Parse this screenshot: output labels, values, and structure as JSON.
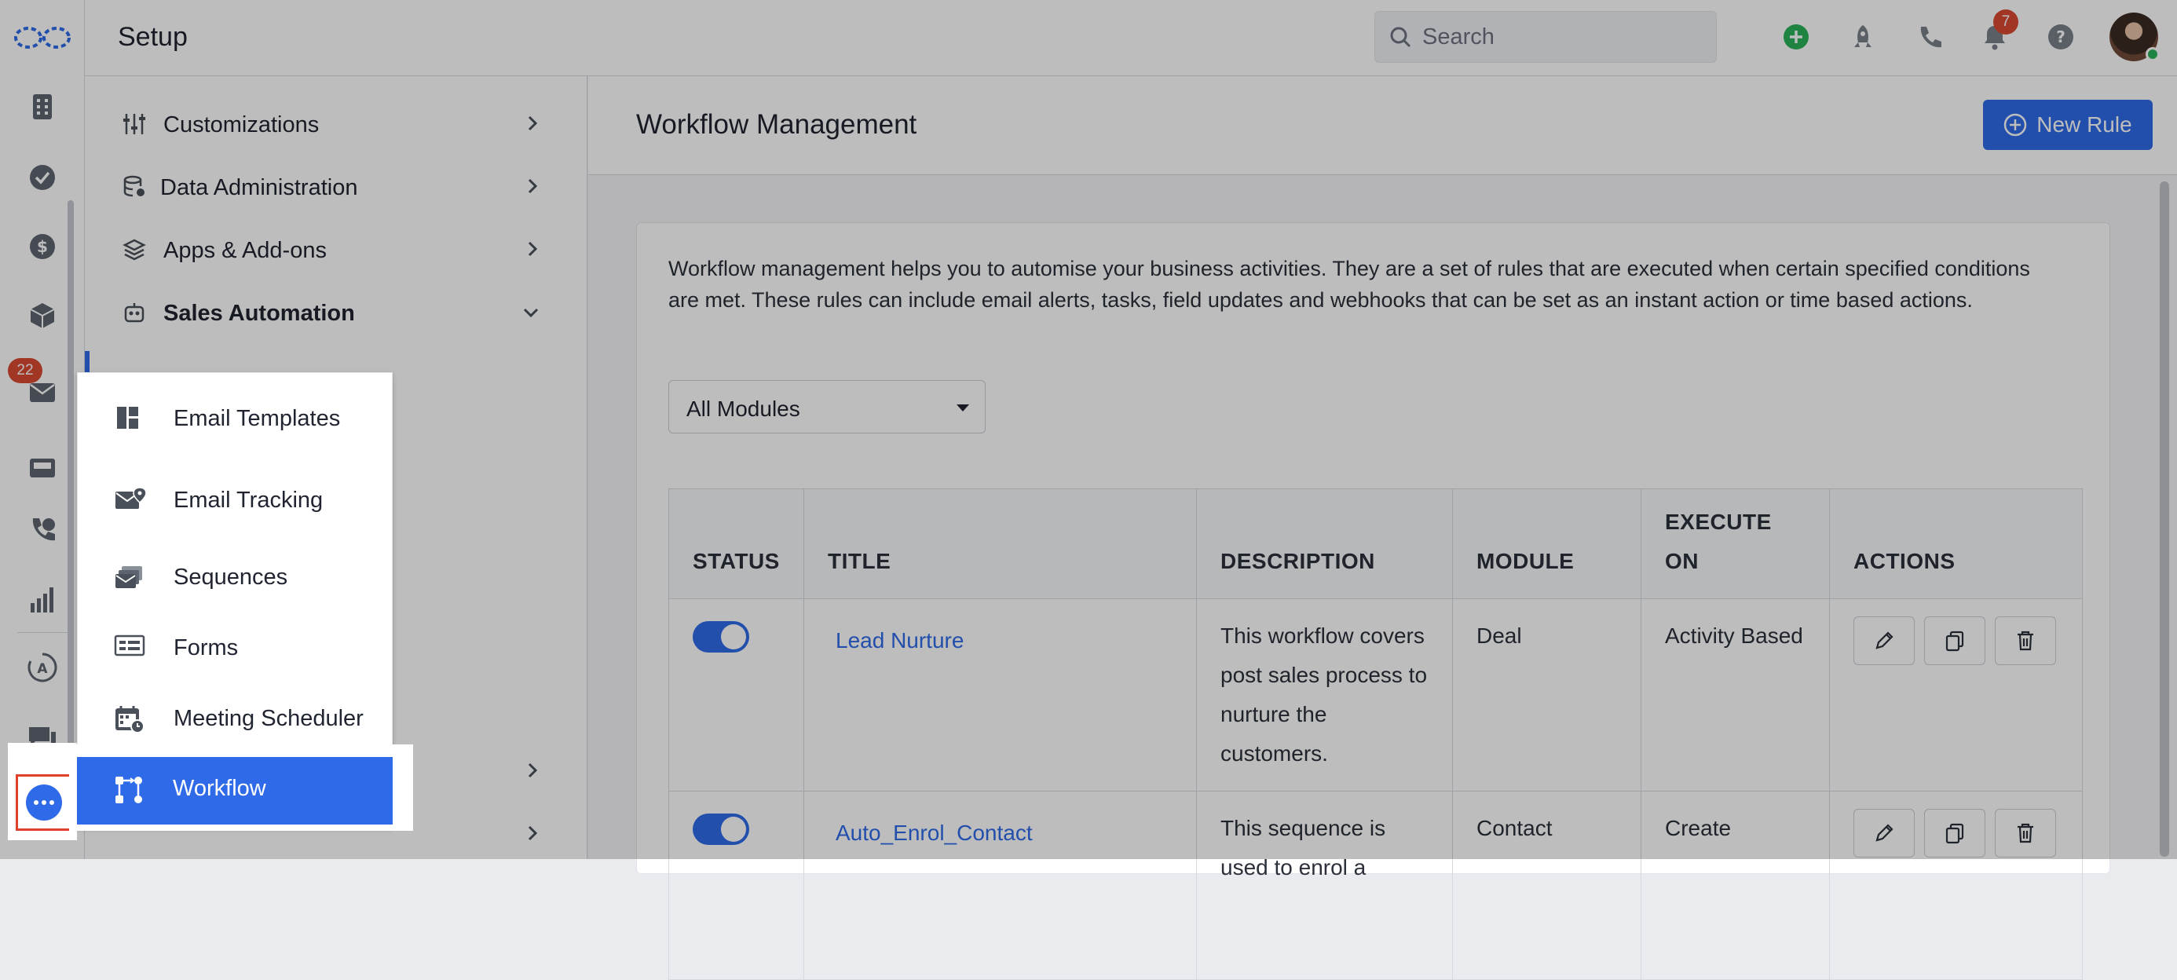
{
  "rail": {
    "mail_badge": "22",
    "icons": [
      "logo-icon",
      "building-icon",
      "check-circle-icon",
      "dollar-circle-icon",
      "cube-icon",
      "mail-icon",
      "inbox-icon",
      "phone-chat-icon",
      "bar-chart-icon",
      "robot-sync-icon",
      "chat-bubbles-icon",
      "more-icon"
    ]
  },
  "header": {
    "title": "Setup",
    "search_placeholder": "Search",
    "notification_count": "7"
  },
  "setup_menu": {
    "items": [
      {
        "label": "Customizations"
      },
      {
        "label": "Data Administration"
      },
      {
        "label": "Apps & Add-ons"
      },
      {
        "label": "Sales Automation"
      }
    ]
  },
  "flyout": {
    "items": [
      {
        "label": "Email Templates"
      },
      {
        "label": "Email Tracking"
      },
      {
        "label": "Sequences"
      },
      {
        "label": "Forms"
      },
      {
        "label": "Meeting Scheduler"
      },
      {
        "label": "Workflow"
      }
    ]
  },
  "main": {
    "title": "Workflow Management",
    "new_rule_label": "New Rule",
    "description": "Workflow management helps you to automise your business activities. They are a set of rules that are executed when certain specified conditions are met. These rules can include email alerts, tasks, field updates and webhooks that can be set as an instant action or time based actions.",
    "module_filter": "All Modules",
    "columns": [
      "STATUS",
      "TITLE",
      "DESCRIPTION",
      "MODULE",
      "EXECUTE ON",
      "ACTIONS"
    ],
    "rows": [
      {
        "status": "on",
        "title": "Lead Nurture",
        "description": "This workflow covers post sales process to nurture the customers.",
        "module": "Deal",
        "execute_on": "Activity Based"
      },
      {
        "status": "on",
        "title": "Auto_Enrol_Contact",
        "description": "This sequence is used to enrol a",
        "module": "Contact",
        "execute_on": "Create"
      }
    ]
  },
  "colors": {
    "accent": "#2f6ae8",
    "badge": "#d94a32",
    "highlight_border": "#e2402e",
    "add_green": "#2ab35a"
  }
}
